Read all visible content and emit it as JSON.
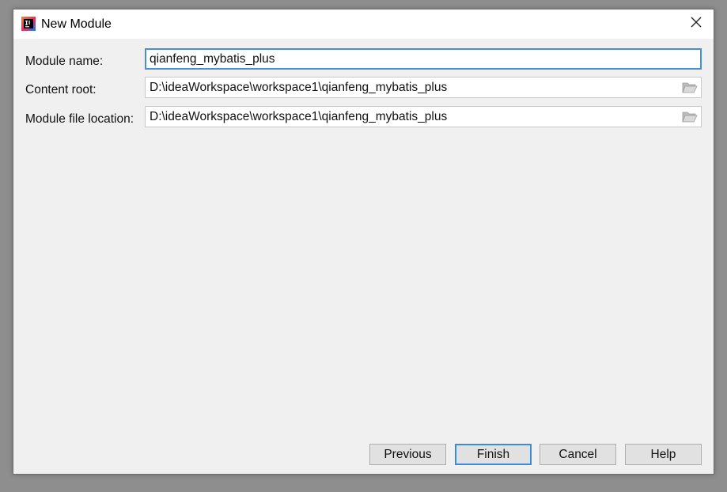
{
  "window": {
    "title": "New Module",
    "app_icon": "intellij-idea-icon",
    "close_icon": "close-icon"
  },
  "form": {
    "module_name": {
      "label": "Module name:",
      "value": "qianfeng_mybatis_plus"
    },
    "content_root": {
      "label": "Content root:",
      "value": "D:\\ideaWorkspace\\workspace1\\qianfeng_mybatis_plus",
      "browse_icon": "folder-open-icon"
    },
    "module_file_location": {
      "label": "Module file location:",
      "value": "D:\\ideaWorkspace\\workspace1\\qianfeng_mybatis_plus",
      "browse_icon": "folder-open-icon"
    }
  },
  "buttons": {
    "previous": "Previous",
    "finish": "Finish",
    "cancel": "Cancel",
    "help": "Help"
  },
  "colors": {
    "focus_border": "#4a8fd6",
    "dialog_bg": "#f0f0f0",
    "button_bg": "#e1e1e1"
  }
}
